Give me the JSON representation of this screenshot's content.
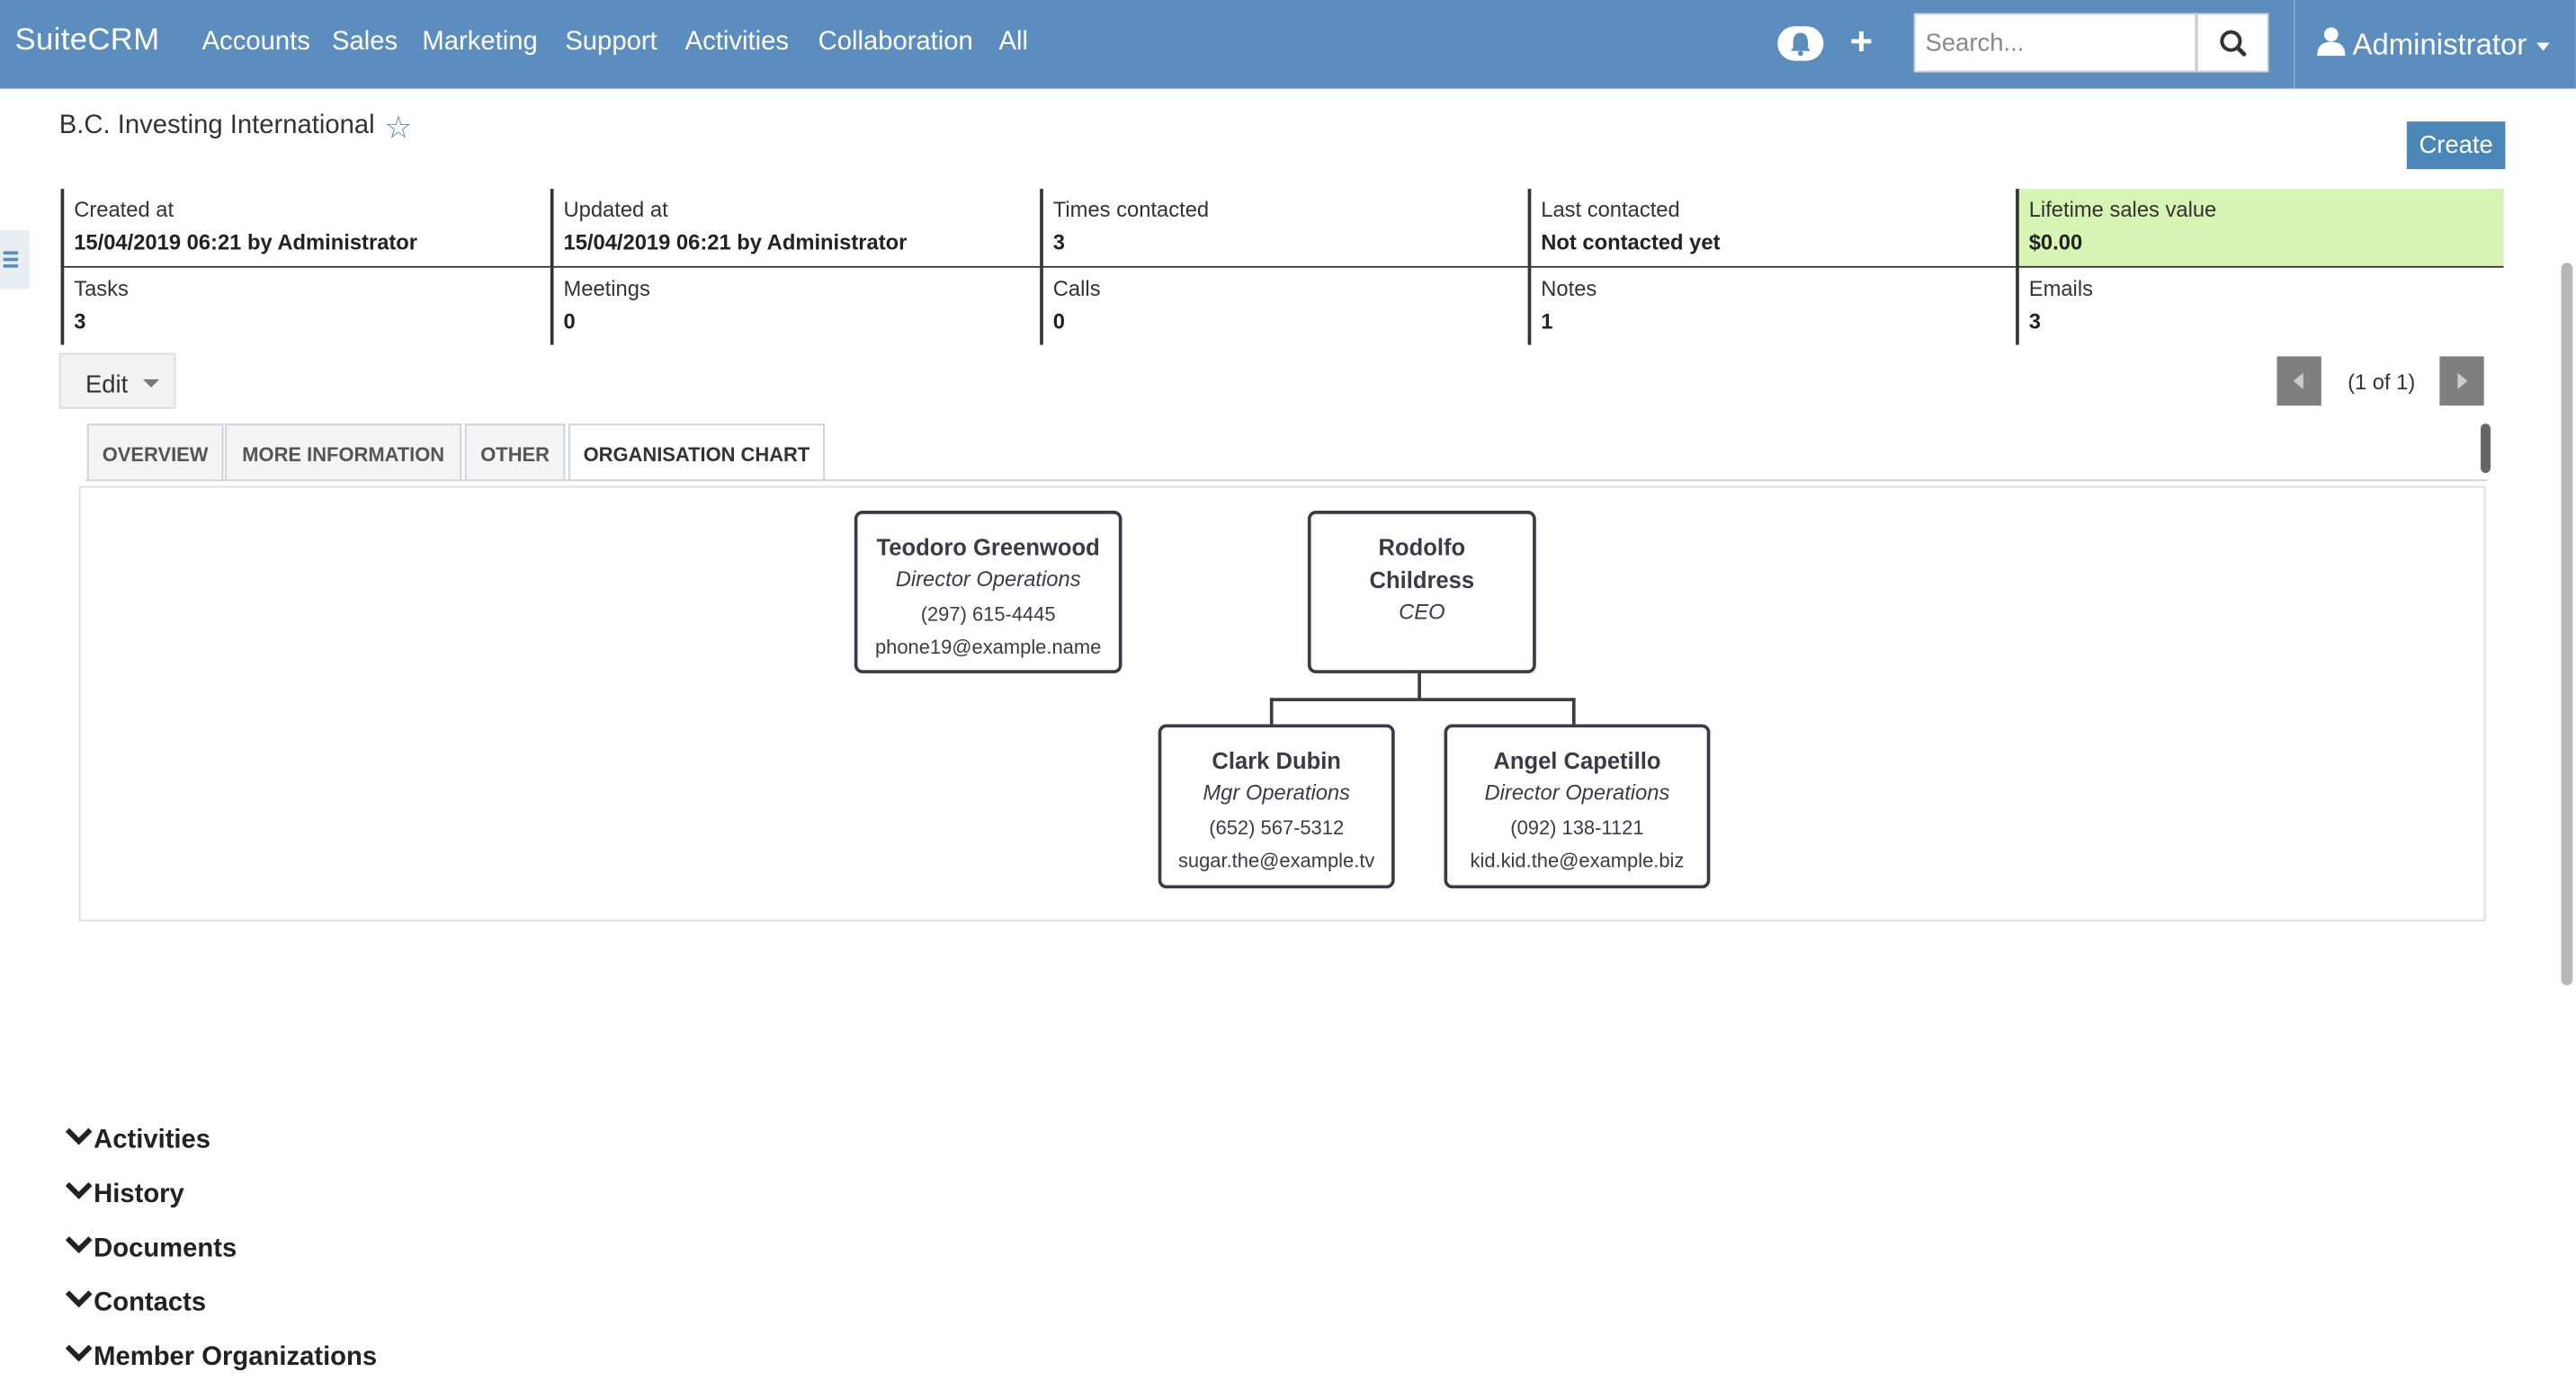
{
  "nav": {
    "brand": "SuiteCRM",
    "items": [
      "Accounts",
      "Sales",
      "Marketing",
      "Support",
      "Activities",
      "Collaboration",
      "All"
    ],
    "search_placeholder": "Search...",
    "user": "Administrator"
  },
  "record": {
    "title": "B.C. Investing International",
    "create_label": "Create"
  },
  "stats": {
    "created_label": "Created at",
    "created_value": "15/04/2019 06:21 by Administrator",
    "updated_label": "Updated at",
    "updated_value": "15/04/2019 06:21 by Administrator",
    "times_label": "Times contacted",
    "times_value": "3",
    "last_label": "Last contacted",
    "last_value": "Not contacted yet",
    "lifetime_label": "Lifetime sales value",
    "lifetime_value": "$0.00",
    "tasks_label": "Tasks",
    "tasks_value": "3",
    "meetings_label": "Meetings",
    "meetings_value": "0",
    "calls_label": "Calls",
    "calls_value": "0",
    "notes_label": "Notes",
    "notes_value": "1",
    "emails_label": "Emails",
    "emails_value": "3",
    "highlight_color": "#d7f4b5"
  },
  "actions": {
    "edit_label": "Edit",
    "pagination": "(1 of 1)"
  },
  "tabs": [
    {
      "label": "OVERVIEW"
    },
    {
      "label": "MORE INFORMATION"
    },
    {
      "label": "OTHER"
    },
    {
      "label": "ORGANISATION CHART"
    }
  ],
  "org_chart": {
    "teodoro": {
      "name": "Teodoro Greenwood",
      "role": "Director Operations",
      "phone": "(297) 615-4445",
      "email": "phone19@example.name"
    },
    "rodolfo": {
      "name_line1": "Rodolfo",
      "name_line2": "Childress",
      "role": "CEO"
    },
    "clark": {
      "name": "Clark Dubin",
      "role": "Mgr Operations",
      "phone": "(652) 567-5312",
      "email": "sugar.the@example.tv"
    },
    "angel": {
      "name": "Angel Capetillo",
      "role": "Director Operations",
      "phone": "(092) 138-1121",
      "email": "kid.kid.the@example.biz"
    }
  },
  "sections": [
    "Activities",
    "History",
    "Documents",
    "Contacts",
    "Member Organizations"
  ],
  "colors": {
    "navbar": "#5b8ebf",
    "create_button": "#4a86b8",
    "card_border": "#3b3b47"
  }
}
